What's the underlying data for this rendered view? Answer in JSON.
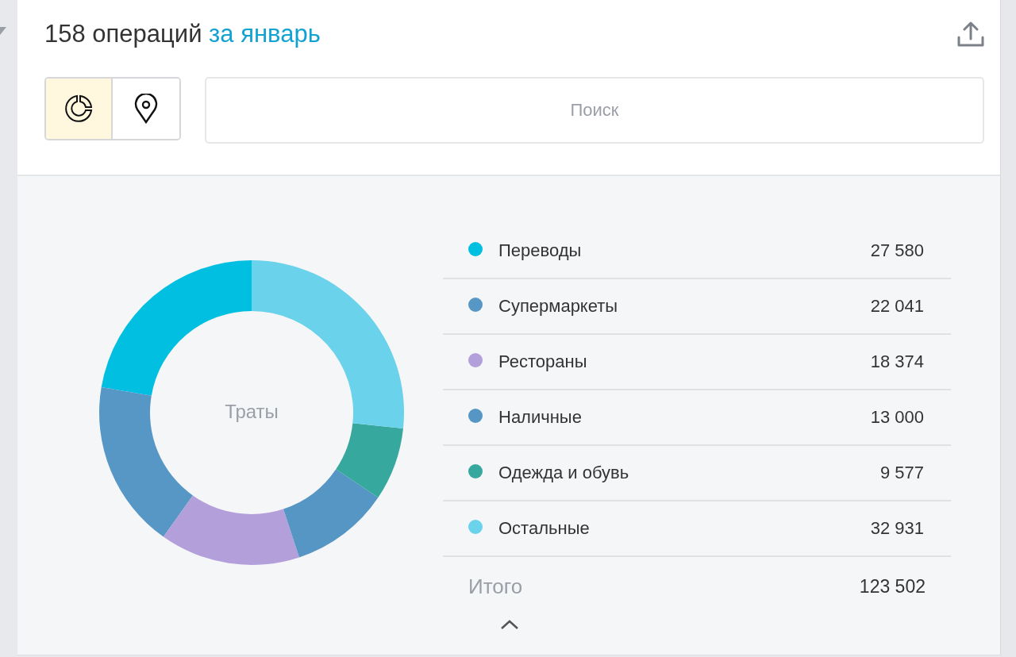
{
  "header": {
    "count": "158 операций",
    "period_link": "за январь"
  },
  "view_toggle": [
    {
      "kind": "chart",
      "selected": true
    },
    {
      "kind": "map",
      "selected": false
    }
  ],
  "search": {
    "placeholder": "Поиск"
  },
  "chart_data": {
    "type": "donut",
    "title": "Траты",
    "categories": [
      "Переводы",
      "Супермаркеты",
      "Рестораны",
      "Наличные",
      "Одежда и обувь",
      "Остальные"
    ],
    "values": [
      22.33,
      17.85,
      14.88,
      10.53,
      7.75,
      26.66
    ]
  },
  "legend": {
    "items": [
      {
        "amount": "27 580",
        "color": "#00bfe0"
      },
      {
        "amount": "22 041",
        "color": "#5797c5"
      },
      {
        "amount": "18 374",
        "color": "#b39fda"
      },
      {
        "amount": "13 000",
        "color": "#5696c4"
      },
      {
        "amount": "9 577",
        "color": "#37a89e"
      },
      {
        "amount": "32 931",
        "color": "#6ad2ea"
      }
    ],
    "total_label": "Итого",
    "total_amount": "123 502"
  }
}
